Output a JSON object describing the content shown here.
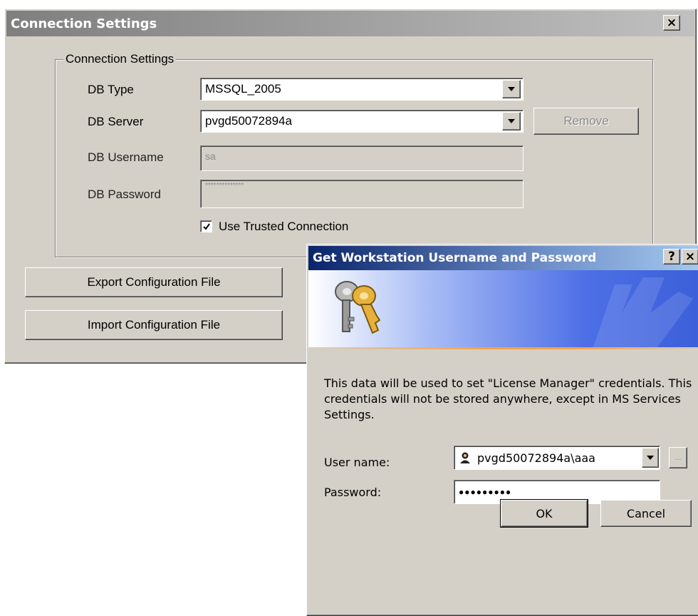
{
  "main_window": {
    "title": "Connection Settings",
    "close_glyph": "×",
    "group_title": "Connection Settings",
    "db_type": {
      "label": "DB Type",
      "value": "MSSQL_2005"
    },
    "db_server": {
      "label": "DB Server",
      "value": "pvgd50072894a"
    },
    "remove_label": "Remove",
    "db_username": {
      "label": "DB Username",
      "value": "sa"
    },
    "db_password": {
      "label": "DB Password",
      "value": "**************"
    },
    "trusted": {
      "label": "Use Trusted Connection",
      "checked": true
    },
    "export_label": "Export Configuration File",
    "import_label": "Import Configuration File"
  },
  "dialog": {
    "title": "Get Workstation Username and Password",
    "help_glyph": "?",
    "close_glyph": "×",
    "description": "This data will be used to set \"License Manager\" credentials. This credentials will not be stored anywhere, except in MS Services Settings.",
    "username": {
      "label": "User name:",
      "value": "pvgd50072894a\\aaa"
    },
    "browse_label": "...",
    "password": {
      "label": "Password:",
      "value": "●●●●●●●●●"
    },
    "ok_label": "OK",
    "cancel_label": "Cancel"
  },
  "colors": {
    "title_gradient_start": "#7f7f7f",
    "title_gradient_end": "#bdbdbd",
    "dialog_title_start": "#0a246a",
    "dialog_title_end": "#a6caf0",
    "banner_accent": "#f5a24a",
    "window_face": "#d4d0c8"
  },
  "icons": [
    "close-icon",
    "help-icon",
    "keys-icon",
    "dropdown-arrow-icon",
    "user-account-icon",
    "checkmark-icon"
  ]
}
